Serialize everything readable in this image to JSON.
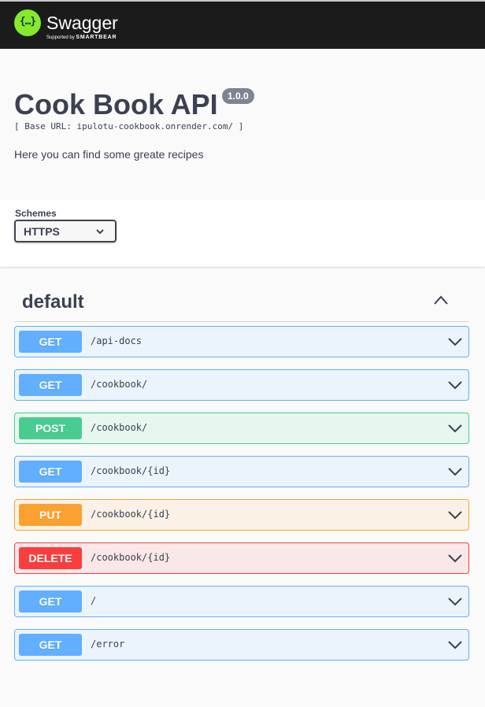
{
  "topbar": {
    "brand_name": "Swagger",
    "brand_trademark": ".",
    "logo_glyph": "{…}",
    "supported_by_prefix": "Supported by",
    "supported_by_company": "SMARTBEAR",
    "logo_color": "#85ea2d"
  },
  "info": {
    "title": "Cook Book API",
    "version": "1.0.0",
    "base_url": "[ Base URL: ipulotu-cookbook.onrender.com/ ]",
    "description": "Here you can find some greate recipes"
  },
  "schemes": {
    "label": "Schemes",
    "selected": "HTTPS",
    "icon": "chevron-down-icon"
  },
  "tag": {
    "name": "default",
    "toggle_icon": "chevron-up-icon"
  },
  "operations": [
    {
      "method": "GET",
      "path": "/api-docs",
      "color": "#61affe"
    },
    {
      "method": "GET",
      "path": "/cookbook/",
      "color": "#61affe"
    },
    {
      "method": "POST",
      "path": "/cookbook/",
      "color": "#49cc90"
    },
    {
      "method": "GET",
      "path": "/cookbook/{id}",
      "color": "#61affe"
    },
    {
      "method": "PUT",
      "path": "/cookbook/{id}",
      "color": "#fca130"
    },
    {
      "method": "DELETE",
      "path": "/cookbook/{id}",
      "color": "#f93e3e"
    },
    {
      "method": "GET",
      "path": "/",
      "color": "#61affe"
    },
    {
      "method": "GET",
      "path": "/error",
      "color": "#61affe"
    }
  ]
}
